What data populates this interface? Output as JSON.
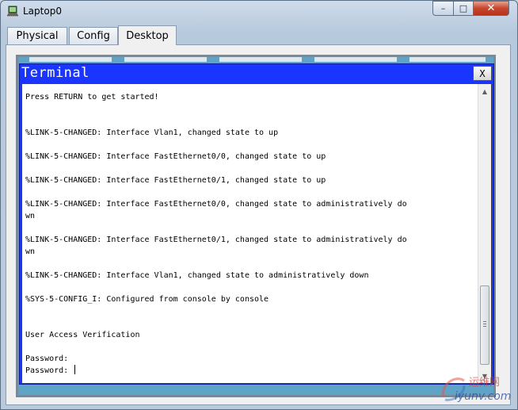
{
  "window": {
    "title": "Laptop0",
    "minimize_glyph": "–",
    "maximize_glyph": "□",
    "close_glyph": "✕"
  },
  "tabs": [
    {
      "label": "Physical",
      "active": false
    },
    {
      "label": "Config",
      "active": false
    },
    {
      "label": "Desktop",
      "active": true
    }
  ],
  "terminal": {
    "title": "Terminal",
    "close_label": "X",
    "lines": [
      "",
      "Press RETURN to get started!",
      "",
      "",
      "%LINK-5-CHANGED: Interface Vlan1, changed state to up",
      "",
      "%LINK-5-CHANGED: Interface FastEthernet0/0, changed state to up",
      "",
      "%LINK-5-CHANGED: Interface FastEthernet0/1, changed state to up",
      "",
      "%LINK-5-CHANGED: Interface FastEthernet0/0, changed state to administratively do",
      "wn",
      "",
      "%LINK-5-CHANGED: Interface FastEthernet0/1, changed state to administratively do",
      "wn",
      "",
      "%LINK-5-CHANGED: Interface Vlan1, changed state to administratively down",
      "",
      "%SYS-5-CONFIG_I: Configured from console by console",
      "",
      "",
      "User Access Verification",
      "",
      "Password: ",
      "Password: "
    ]
  },
  "watermark": {
    "cn": "运维网",
    "en": "iyunv.com"
  },
  "colors": {
    "terminal_title_bar": "#1a35ff",
    "terminal_background": "#ffffff"
  }
}
